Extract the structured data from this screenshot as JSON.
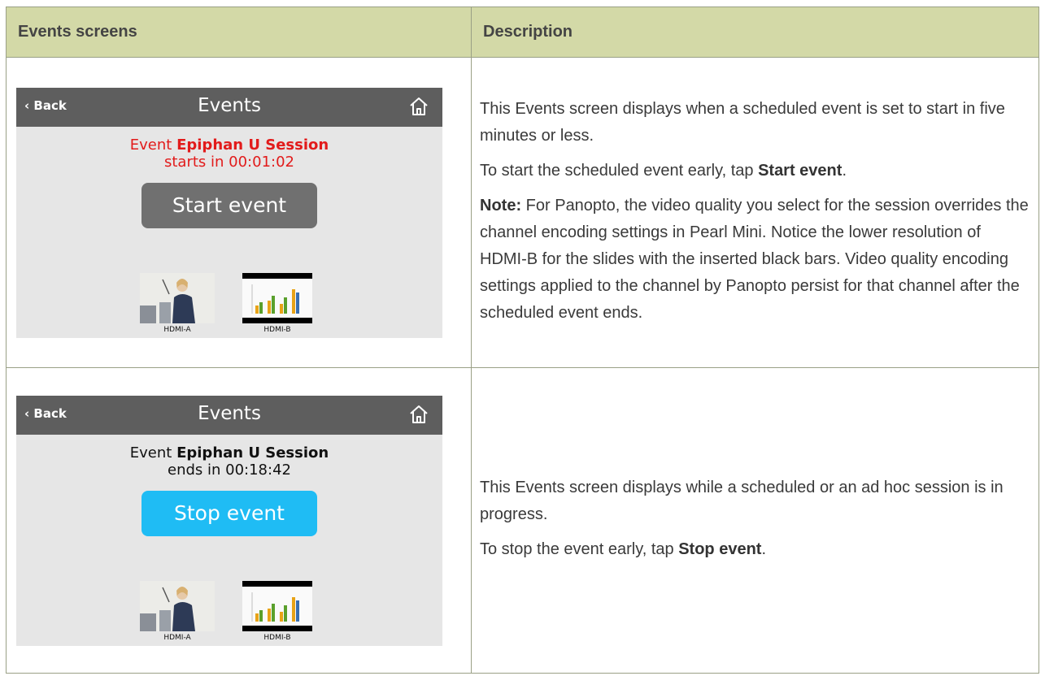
{
  "table": {
    "headers": [
      "Events screens",
      "Description"
    ]
  },
  "rows": [
    {
      "screen": {
        "back_label": "Back",
        "title": "Events",
        "msg_prefix": "Event ",
        "event_name": "Epiphan U Session",
        "time_line": "starts in 00:01:02",
        "button_label": "Start event",
        "thumb_a": "HDMI-A",
        "thumb_b": "HDMI-B"
      },
      "desc": {
        "p1": "This Events screen displays when a scheduled event is set to start in five minutes or less.",
        "p2_prefix": "To start the scheduled event early, tap ",
        "p2_bold": "Start event",
        "p2_suffix": ".",
        "p3_bold": "Note:",
        "p3_text": " For Panopto, the video quality you select for the session overrides the channel encoding settings in Pearl Mini. Notice the lower resolution of HDMI-B for the slides with the inserted black bars. Video quality encoding settings applied to the channel by Panopto persist for that channel after the scheduled event ends."
      }
    },
    {
      "screen": {
        "back_label": "Back",
        "title": "Events",
        "msg_prefix": "Event ",
        "event_name": "Epiphan U Session",
        "time_line": "ends in 00:18:42",
        "button_label": "Stop event",
        "thumb_a": "HDMI-A",
        "thumb_b": "HDMI-B"
      },
      "desc": {
        "p1": "This Events screen displays while a scheduled or an ad hoc session is in progress.",
        "p2_prefix": "To stop the event early, tap ",
        "p2_bold": "Stop event",
        "p2_suffix": "."
      }
    }
  ],
  "colors": {
    "header_bg": "#d3d9a7",
    "start_event_text": "#e21b1b",
    "stop_button": "#1fbcf4",
    "start_button": "#707070"
  }
}
